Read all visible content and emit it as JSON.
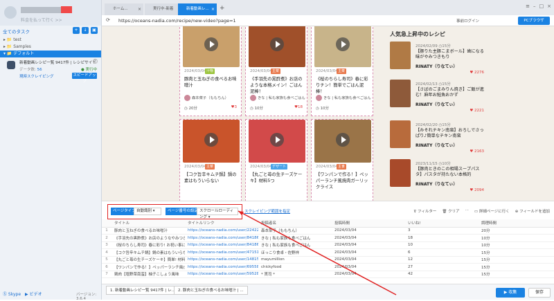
{
  "sidebar": {
    "subtitle": "料金を払って行く >>",
    "tasks_header": "全てのタスク",
    "tree": [
      "test",
      "Samples",
      "デフォルト"
    ],
    "task": {
      "title": "新着動画レシピ一覧 9417件 | レシピサイト",
      "data_label": "データ数:",
      "data_count": "56",
      "status": "● 実行中",
      "local_run": "現時スクレイピング",
      "speed_button": "スピードアップ"
    },
    "footer": {
      "skype": "Skype",
      "video": "ビデオ",
      "version": "バージョン: 3.6.4"
    }
  },
  "browser": {
    "tabs": [
      "ホーム...",
      "実行中-新着",
      "新着動画レ..."
    ],
    "url": "https://oceans-nadia.com/recipe/new-video?page=1",
    "login_label": "事前ログイン",
    "pc_browser": "PCブラウザ"
  },
  "recipes": [
    {
      "date": "2024/03/04",
      "tag": "汁物",
      "tag_color": "#9ac33a",
      "title": "豚肉と玉ねぎの食べるお味噌汁",
      "author": "森本菜子（ももちん）",
      "time": "20分",
      "likes": "3"
    },
    {
      "date": "2024/03/04",
      "tag": "主菜",
      "tag_color": "#e8774a",
      "title": "《手羽先の黒酢煮》お店のような本格メイン！ごはん泥棒！",
      "author": "きな | 私も家族も食べごはん",
      "time": "10分",
      "likes": "18"
    },
    {
      "date": "2024/03/04",
      "tag": "主菜",
      "tag_color": "#e8774a",
      "title": "《桜のちらし寿司》春に彩りチン！簡単でごはん泥棒！",
      "author": "きな | 私も家族も食べごはん",
      "time": "10分",
      "likes": ""
    },
    {
      "date": "2024/03/04",
      "tag": "主菜",
      "tag_color": "#e8774a",
      "title": "【コク旨辛キムチ鍋】鍋の素はもういらない",
      "author": "",
      "time": "",
      "likes": ""
    },
    {
      "date": "2024/03/04",
      "tag": "デザート",
      "tag_color": "#4aa3e8",
      "title": "【丸ごと苺の生チーズケーキ】材料5つ",
      "author": "",
      "time": "",
      "likes": ""
    },
    {
      "date": "2024/03/04",
      "tag": "主食",
      "tag_color": "#e8774a",
      "title": "【ワンパンで作る！】ペッパーランチ風焼肉ガーリックライス",
      "author": "",
      "time": "",
      "likes": ""
    }
  ],
  "popular": {
    "header": "人気急上昇中のレシピ",
    "items": [
      {
        "date": "2024/02/09",
        "time": "15分",
        "title": "【豚りた主豚こまボール】歯になる味がやみつきもり",
        "author": "RINATY（りなてぃ）",
        "likes": "2276"
      },
      {
        "date": "2024/02/13",
        "time": "15分",
        "title": "【さばのごまみりん焼き】ご飯が進む！麻年お鮭魚おかず",
        "author": "RINATY（りなてぃ）",
        "likes": "2221"
      },
      {
        "date": "2024/02/20",
        "time": "15分",
        "title": "【みそれチキン南蛮】おろしでさっぱり♪簡単なチキン南蛮",
        "author": "RINATY（りなてぃ）",
        "likes": "2163"
      },
      {
        "date": "2023/11/15",
        "time": "10分",
        "title": "【豚肉ときのこの相場スープパスタ】パスタが持たない本格的",
        "author": "RINATY（りなてぃ）",
        "likes": "2094"
      }
    ]
  },
  "toolbar": {
    "page_type_label": "ページタイプ",
    "page_type_value": "自動識別",
    "page_settings_label": "ページ番号の設定",
    "page_settings_value": "スクロールローディング",
    "scrape_link": "スクレイピング範囲を指定",
    "filter": "フィルター",
    "clear": "クリア",
    "more": "詳細ページに行く",
    "add_field": "フィールドを追加"
  },
  "table": {
    "headers": [
      "",
      "タイトル",
      "タイトルリンク",
      "投稿者名",
      "投稿時間",
      "いいね!",
      "調理時間"
    ],
    "rows": [
      [
        "1",
        "豚肉と玉ねぎの食べるお味噌汁",
        "https://oceans-nadia.com/user/22422/recip...",
        "森本菜子（ももちん）",
        "2024/03/04",
        "3",
        "20分"
      ],
      [
        "2",
        "《手羽先の黒酢煮》お店のようなやみつき...",
        "https://oceans-nadia.com/user/841866/recip...",
        "きな | 私も家族も食べごはん",
        "2024/03/04",
        "18",
        "10分"
      ],
      [
        "3",
        "《桜のちらし寿司》春に彩り! お祝い事に...",
        "https://oceans-nadia.com/user/841866/recip...",
        "きな | 私も家族も食べごはん",
        "2024/03/04",
        "10",
        "10分"
      ],
      [
        "4",
        "【コク旨辛キムチ鍋】鍋の素はもういらな...",
        "https://oceans-nadia.com/user/471513/recip...",
        "ほっこり食卓・佐野祥",
        "2024/03/04",
        "6",
        "15分"
      ],
      [
        "5",
        "【丸ごと苺の生チーズケーキ】簡単! 材料5...",
        "https://oceans-nadia.com/user/148150/recip...",
        "mayumillion",
        "2024/03/04",
        "12",
        "15分"
      ],
      [
        "6",
        "【ワンパンで作る！】ペッパーランチ風(焼肉...",
        "https://oceans-nadia.com/user/695588/recip...",
        "chickyfood",
        "2024/03/04",
        "27",
        "15分"
      ],
      [
        "7",
        "鶏肉【塩野菜南蛮】柚子こしょう風味",
        "https://oceans-nadia.com/user/59528/recip...",
        "* 貫司 *",
        "2024/03/04",
        "42",
        "15分"
      ]
    ]
  },
  "bottom": {
    "tab1": "1. 新着動画レシピ一覧 9417件 | レ...",
    "tab2": "2. 豚肉と玉ねぎの食べるお味噌汁 | ...",
    "collect": "▶ 収集",
    "save": "保存"
  }
}
